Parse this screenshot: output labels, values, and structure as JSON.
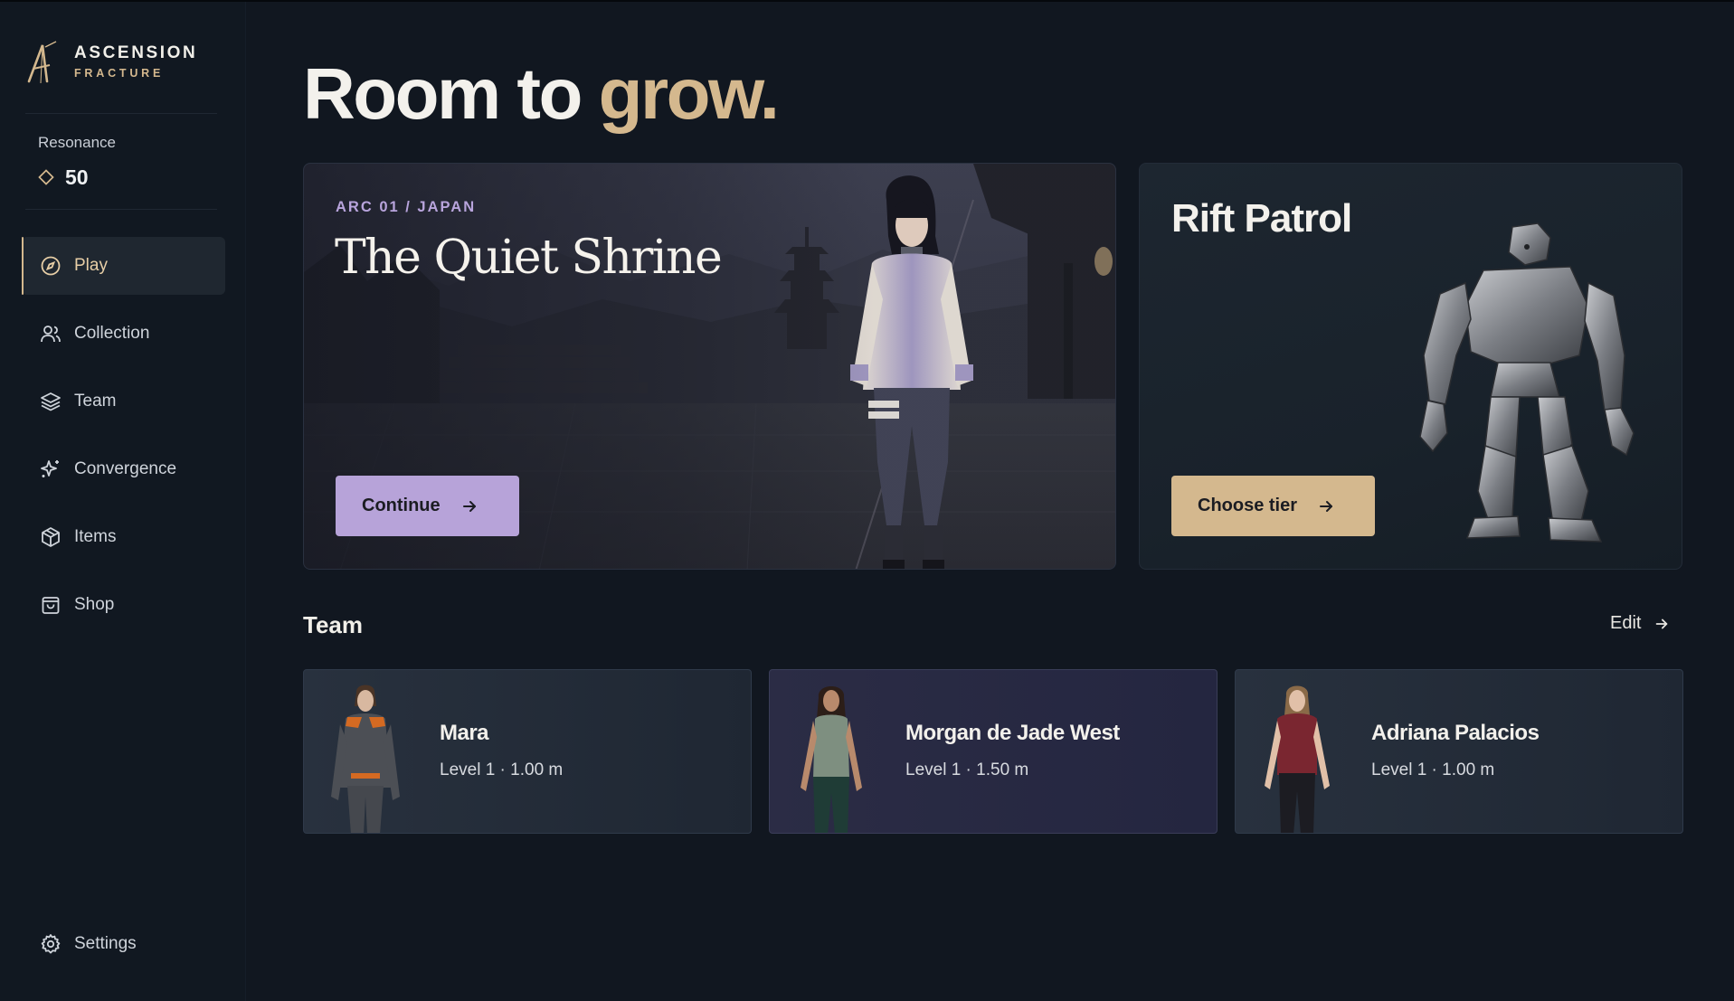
{
  "brand": {
    "name": "ASCENSION",
    "sub": "FRACTURE"
  },
  "resonance": {
    "label": "Resonance",
    "value": "50"
  },
  "nav": [
    {
      "label": "Play",
      "icon": "compass-icon",
      "active": true
    },
    {
      "label": "Collection",
      "icon": "users-icon"
    },
    {
      "label": "Team",
      "icon": "layers-icon"
    },
    {
      "label": "Convergence",
      "icon": "sparkles-icon"
    },
    {
      "label": "Items",
      "icon": "package-icon"
    },
    {
      "label": "Shop",
      "icon": "shopping-bag-icon"
    }
  ],
  "settings": {
    "label": "Settings",
    "icon": "gear-icon"
  },
  "headline": {
    "part1": "Room to",
    "part2": "grow."
  },
  "shrine_card": {
    "arc": "ARC 01 / JAPAN",
    "title": "The Quiet Shrine",
    "button": "Continue"
  },
  "rift_card": {
    "title": "Rift Patrol",
    "button": "Choose tier"
  },
  "team": {
    "heading": "Team",
    "edit": "Edit",
    "members": [
      {
        "name": "Mara",
        "meta": "Level 1 · 1.00 m"
      },
      {
        "name": "Morgan de Jade West",
        "meta": "Level 1 · 1.50 m"
      },
      {
        "name": "Adriana Palacios",
        "meta": "Level 1 · 1.00 m"
      }
    ]
  },
  "colors": {
    "background": "#111720",
    "accent_gold": "#d4b88e",
    "accent_lavender": "#b7a3d9"
  }
}
